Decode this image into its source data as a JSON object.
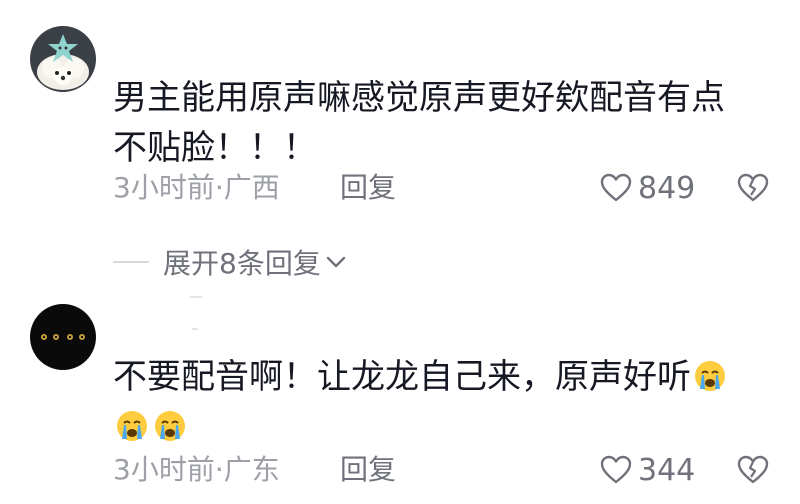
{
  "comments": [
    {
      "avatar_icon": "white-puppy-with-star-toy-avatar",
      "text_line1": "男主能用原声嘛感觉原声更好欸配音有点",
      "text_line2": "不贴脸！！！",
      "meta": "3小时前·广西",
      "reply_label": "回复",
      "likes": "849"
    },
    {
      "avatar_icon": "black-cat-eyes-avatar",
      "text": "不要配音啊！让龙龙自己来，原声好听",
      "emoji": "crying-face-emoji",
      "meta": "3小时前·广东",
      "reply_label": "回复",
      "likes": "344"
    }
  ],
  "expand_replies": "展开8条回复",
  "colors": {
    "text": "#161823",
    "meta": "#9ea0a8",
    "secondary": "#70727b",
    "divider": "#d6d7db"
  }
}
